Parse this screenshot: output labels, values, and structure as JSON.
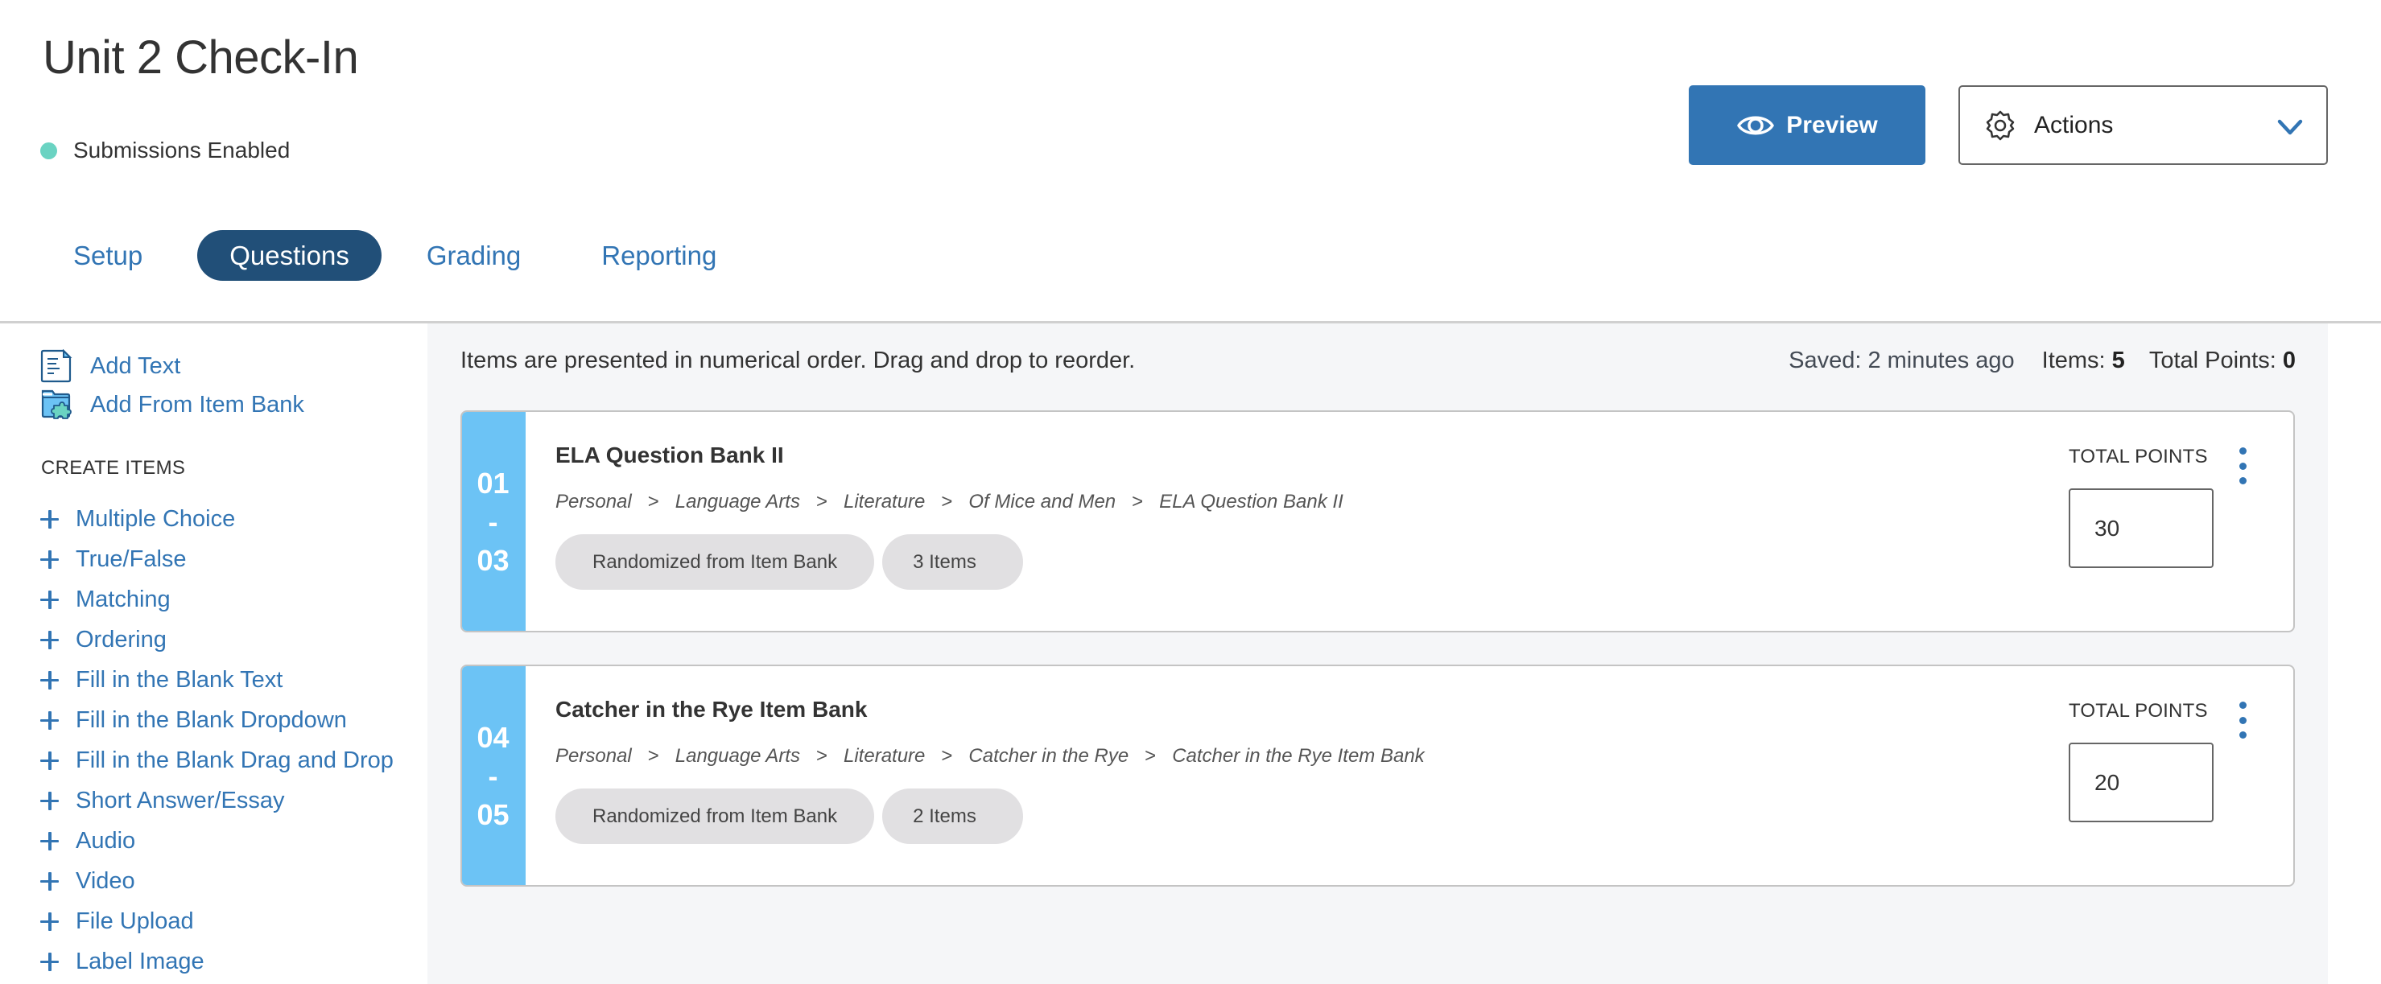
{
  "header": {
    "title": "Unit 2 Check-In",
    "status": {
      "label": "Submissions Enabled",
      "color": "#6ad3c2"
    },
    "preview_label": "Preview",
    "actions_label": "Actions"
  },
  "tabs": [
    {
      "label": "Setup",
      "active": false
    },
    {
      "label": "Questions",
      "active": true
    },
    {
      "label": "Grading",
      "active": false
    },
    {
      "label": "Reporting",
      "active": false
    }
  ],
  "sidebar": {
    "add_text": "Add Text",
    "add_from_bank": "Add From Item Bank",
    "create_heading": "CREATE ITEMS",
    "create_items": [
      "Multiple Choice",
      "True/False",
      "Matching",
      "Ordering",
      "Fill in the Blank Text",
      "Fill in the Blank Dropdown",
      "Fill in the Blank Drag and Drop",
      "Short Answer/Essay",
      "Audio",
      "Video",
      "File Upload",
      "Label Image"
    ]
  },
  "main": {
    "hint": "Items are presented in numerical order. Drag and drop to reorder.",
    "saved": "Saved: 2 minutes ago",
    "items_label": "Items:",
    "items_count": "5",
    "total_points_label": "Total Points:",
    "total_points_value": "0",
    "cards": [
      {
        "range_start": "01",
        "range_sep": "-",
        "range_end": "03",
        "title": "ELA Question Bank II",
        "breadcrumb": [
          "Personal",
          "Language Arts",
          "Literature",
          "Of Mice and Men",
          "ELA Question Bank II"
        ],
        "tag": "Randomized from Item Bank",
        "count": "3 Items",
        "points_label": "TOTAL POINTS",
        "points_value": "30"
      },
      {
        "range_start": "04",
        "range_sep": "-",
        "range_end": "05",
        "title": "Catcher in the Rye Item Bank",
        "breadcrumb": [
          "Personal",
          "Language Arts",
          "Literature",
          "Catcher in the Rye",
          "Catcher in the Rye Item Bank"
        ],
        "tag": "Randomized from Item Bank",
        "count": "2 Items",
        "points_label": "TOTAL POINTS",
        "points_value": "20"
      }
    ]
  },
  "colors": {
    "brand_blue": "#3275b4",
    "active_tab": "#214f78",
    "strip_blue": "#6cc3f5",
    "status_green": "#6ad3c2"
  },
  "breadcrumb_separator": ">"
}
